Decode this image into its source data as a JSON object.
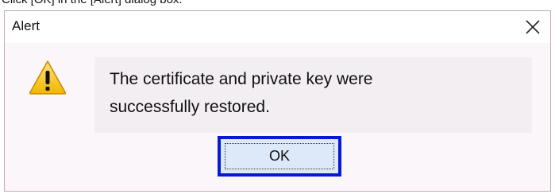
{
  "instruction": "Click [OK] in the [Alert] dialog box.",
  "dialog": {
    "title": "Alert",
    "message_line1": "The certificate and private key were",
    "message_line2": "successfully restored.",
    "ok_label": "OK",
    "icons": {
      "close": "close-icon",
      "warning": "warning-icon"
    },
    "colors": {
      "focus_border": "#0818d8",
      "button_fill": "#dde9f8",
      "dialog_background": "#fbf6f9",
      "warning_fill": "#f5c400"
    }
  }
}
